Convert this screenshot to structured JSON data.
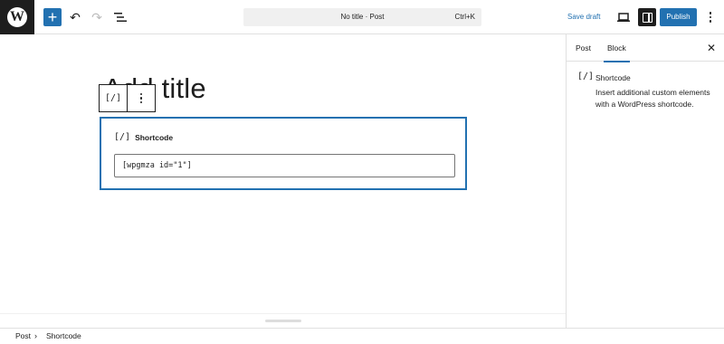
{
  "topbar": {
    "logo_glyph": "W",
    "add_icon_glyph": "+",
    "undo_glyph": "↶",
    "redo_glyph": "↷",
    "command": {
      "title": "No title · Post",
      "shortcut": "Ctrl+K"
    },
    "save_draft_label": "Save draft",
    "publish_label": "Publish"
  },
  "editor": {
    "title_text": "Add title",
    "toolbar": {
      "block_icon_glyph": "[/]"
    },
    "shortcode_block": {
      "icon_glyph": "[/]",
      "label": "Shortcode",
      "value": "[wpgmza id=\"1\"]"
    }
  },
  "sidebar": {
    "tabs": [
      {
        "label": "Post"
      },
      {
        "label": "Block"
      }
    ],
    "active_tab": "Block",
    "close_glyph": "✕",
    "block_card": {
      "icon_glyph": "[/]",
      "title": "Shortcode",
      "description": "Insert additional custom elements with a WordPress shortcode."
    }
  },
  "breadcrumb": {
    "items": [
      "Post",
      "Shortcode"
    ],
    "separator": "›"
  },
  "colors": {
    "accent": "#2271b1",
    "dark": "#1e1e1e",
    "border": "#e0e0e0"
  }
}
